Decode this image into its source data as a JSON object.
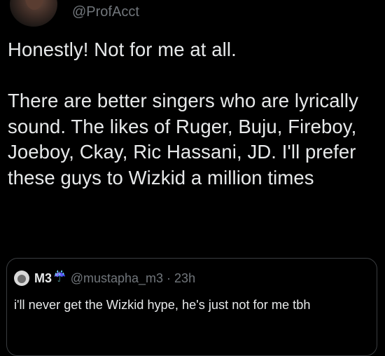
{
  "tweet": {
    "handle": "@ProfAcct",
    "text": "Honestly! Not for me at all.\n\nThere are better singers who are lyrically sound. The likes of Ruger, Buju, Fireboy, Joeboy, Ckay, Ric Hassani, JD. I'll prefer these guys to Wizkid a million times"
  },
  "quote": {
    "name": "M3",
    "emoji": "☔",
    "handle": "@mustapha_m3",
    "separator": "·",
    "time": "23h",
    "text": "i'll never get the Wizkid hype, he's just not for me tbh"
  },
  "colors": {
    "background": "#000000",
    "text": "#e7e9ea",
    "muted": "#71767b",
    "border": "#3a3d40"
  }
}
